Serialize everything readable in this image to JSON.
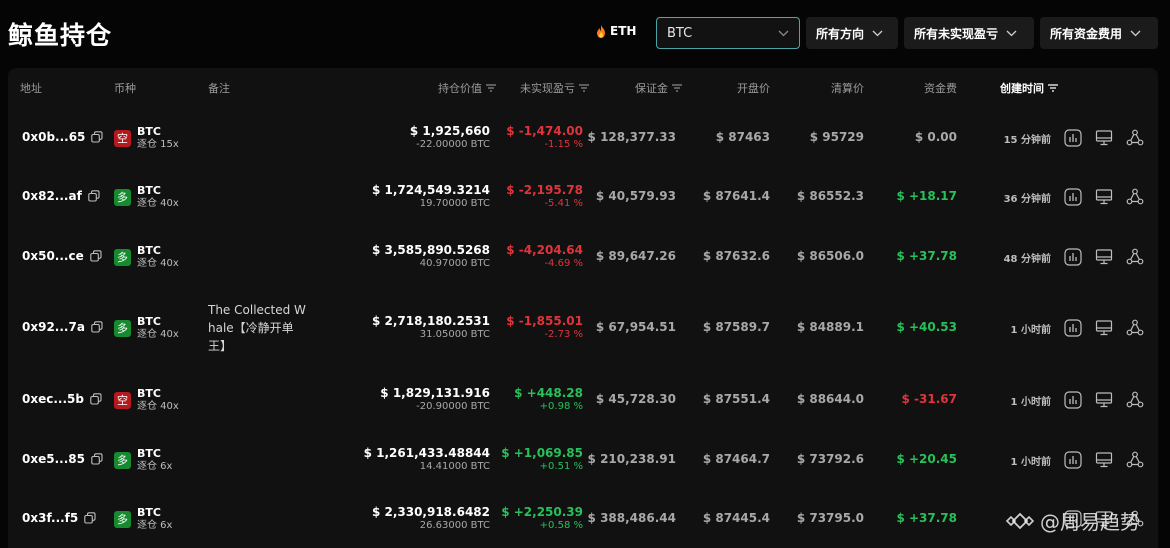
{
  "header": {
    "title": "鲸鱼持仓",
    "eth_label": "ETH",
    "search_value": "BTC",
    "filters": [
      "所有方向",
      "所有未实现盈亏",
      "所有资金费用"
    ]
  },
  "columns": {
    "address": "地址",
    "coin": "币种",
    "note": "备注",
    "value": "持仓价值",
    "pnl": "未实现盈亏",
    "margin": "保证金",
    "entry": "开盘价",
    "liq": "清算价",
    "funding": "资金费",
    "created": "创建时间"
  },
  "rows": [
    {
      "address": "0x0b...65",
      "side": "空",
      "side_type": "short",
      "coin": "BTC",
      "leverage": "逐仓 15x",
      "note": "",
      "value": "$ 1,925,660",
      "size": "-22.00000 BTC",
      "pnl": "$ -1,474.00",
      "pnl_pct": "-1.15 %",
      "pnl_sign": "neg",
      "margin": "$ 128,377.33",
      "entry": "$ 87463",
      "liq": "$ 95729",
      "funding": "$ 0.00",
      "funding_sign": "zero",
      "time": "15 分钟前"
    },
    {
      "address": "0x82...af",
      "side": "多",
      "side_type": "long",
      "coin": "BTC",
      "leverage": "逐仓 40x",
      "note": "",
      "value": "$ 1,724,549.3214",
      "size": "19.70000 BTC",
      "pnl": "$ -2,195.78",
      "pnl_pct": "-5.41 %",
      "pnl_sign": "neg",
      "margin": "$ 40,579.93",
      "entry": "$ 87641.4",
      "liq": "$ 86552.3",
      "funding": "$ +18.17",
      "funding_sign": "pos",
      "time": "36 分钟前"
    },
    {
      "address": "0x50...ce",
      "side": "多",
      "side_type": "long",
      "coin": "BTC",
      "leverage": "逐仓 40x",
      "note": "",
      "value": "$ 3,585,890.5268",
      "size": "40.97000 BTC",
      "pnl": "$ -4,204.64",
      "pnl_pct": "-4.69 %",
      "pnl_sign": "neg",
      "margin": "$ 89,647.26",
      "entry": "$ 87632.6",
      "liq": "$ 86506.0",
      "funding": "$ +37.78",
      "funding_sign": "pos",
      "time": "48 分钟前"
    },
    {
      "address": "0x92...7a",
      "side": "多",
      "side_type": "long",
      "coin": "BTC",
      "leverage": "逐仓 40x",
      "note": "The Collected Whale【冷静开单王】",
      "value": "$ 2,718,180.2531",
      "size": "31.05000 BTC",
      "pnl": "$ -1,855.01",
      "pnl_pct": "-2.73 %",
      "pnl_sign": "neg",
      "margin": "$ 67,954.51",
      "entry": "$ 87589.7",
      "liq": "$ 84889.1",
      "funding": "$ +40.53",
      "funding_sign": "pos",
      "time": "1 小时前"
    },
    {
      "address": "0xec...5b",
      "side": "空",
      "side_type": "short",
      "coin": "BTC",
      "leverage": "逐仓 40x",
      "note": "",
      "value": "$ 1,829,131.916",
      "size": "-20.90000 BTC",
      "pnl": "$ +448.28",
      "pnl_pct": "+0.98 %",
      "pnl_sign": "pos",
      "margin": "$ 45,728.30",
      "entry": "$ 87551.4",
      "liq": "$ 88644.0",
      "funding": "$ -31.67",
      "funding_sign": "neg",
      "time": "1 小时前"
    },
    {
      "address": "0xe5...85",
      "side": "多",
      "side_type": "long",
      "coin": "BTC",
      "leverage": "逐仓 6x",
      "note": "",
      "value": "$ 1,261,433.48844",
      "size": "14.41000 BTC",
      "pnl": "$ +1,069.85",
      "pnl_pct": "+0.51 %",
      "pnl_sign": "pos",
      "margin": "$ 210,238.91",
      "entry": "$ 87464.7",
      "liq": "$ 73792.6",
      "funding": "$ +20.45",
      "funding_sign": "pos",
      "time": "1 小时前"
    },
    {
      "address": "0x3f...f5",
      "side": "多",
      "side_type": "long",
      "coin": "BTC",
      "leverage": "逐仓 6x",
      "note": "",
      "value": "$ 2,330,918.6482",
      "size": "26.63000 BTC",
      "pnl": "$ +2,250.39",
      "pnl_pct": "+0.58 %",
      "pnl_sign": "pos",
      "margin": "$ 388,486.44",
      "entry": "$ 87445.4",
      "liq": "$ 73795.0",
      "funding": "$ +37.78",
      "funding_sign": "pos",
      "time": ""
    }
  ],
  "watermark": "@周易趋势",
  "colors": {
    "background": "#050505",
    "panel": "#111111",
    "accent": "#4ba5a8",
    "positive": "#28c05a",
    "negative": "#e0343c",
    "long_badge": "#168a2e",
    "short_badge": "#b3191e"
  }
}
